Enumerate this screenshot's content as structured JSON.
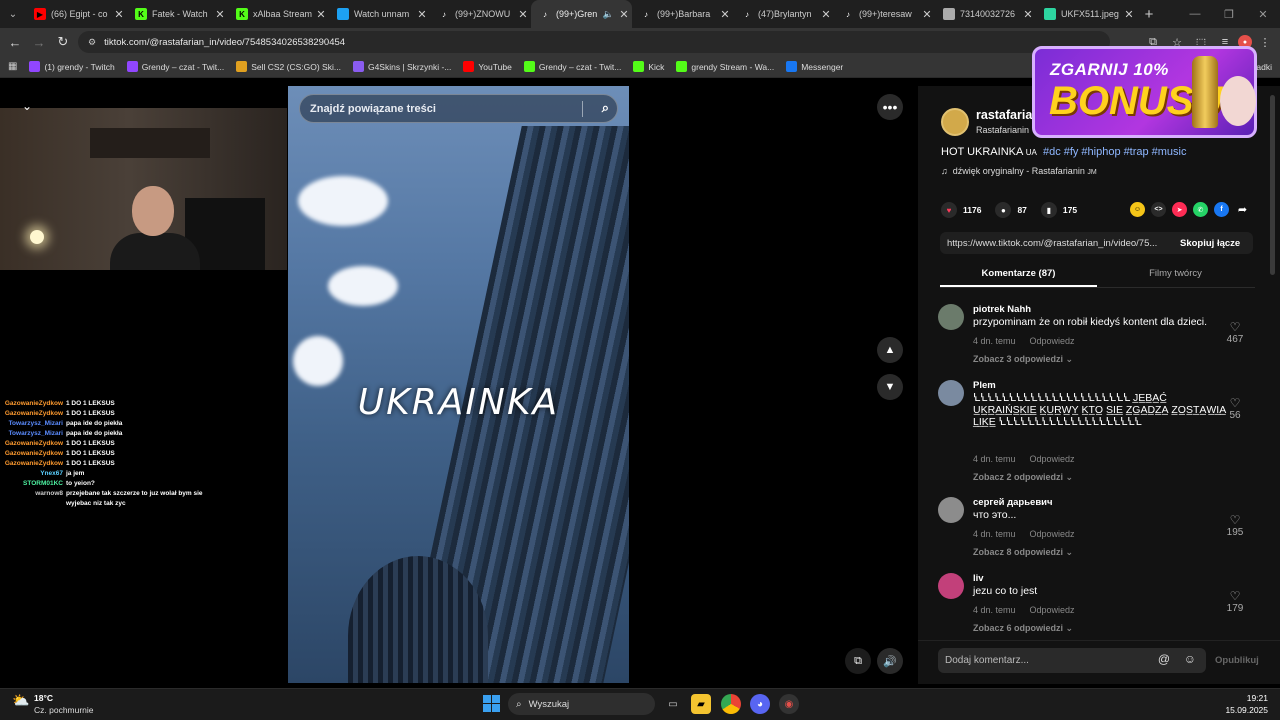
{
  "browser": {
    "tabs": [
      {
        "label": "(66) Egipt - co",
        "icon": "youtube-icon",
        "color": "#ff0000"
      },
      {
        "label": "Fatek - Watch",
        "icon": "kick-icon",
        "color": "#53fc18"
      },
      {
        "label": "xAlbaa Stream",
        "icon": "kick-icon",
        "color": "#53fc18"
      },
      {
        "label": "Watch unnam",
        "icon": "globe-icon",
        "color": "#1da1f2"
      },
      {
        "label": "(99+)ZNOWU",
        "icon": "tiktok-icon",
        "color": "#ffffff"
      },
      {
        "label": "(99+)Gren",
        "icon": "tiktok-icon",
        "color": "#ffffff",
        "active": true
      },
      {
        "label": "(99+)Barbara",
        "icon": "tiktok-icon",
        "color": "#ffffff"
      },
      {
        "label": "(47)Brylantyn",
        "icon": "tiktok-icon",
        "color": "#ffffff"
      },
      {
        "label": "(99+)teresaw",
        "icon": "tiktok-icon",
        "color": "#ffffff"
      },
      {
        "label": "73140032726",
        "icon": "globe-icon",
        "color": "#aaaaaa"
      },
      {
        "label": "UKFX511.jpeg",
        "icon": "image-icon",
        "color": "#2dd4a0"
      }
    ],
    "url": "tiktok.com/@rastafarian_in/video/7548534026538290454",
    "bookmarks": [
      {
        "label": "(1) grendy - Twitch",
        "icon": "twitch-icon",
        "color": "#9146ff"
      },
      {
        "label": "Grendy – czat - Twit...",
        "icon": "twitch-icon",
        "color": "#9146ff"
      },
      {
        "label": "Sell CS2 (CS:GO) Ski...",
        "icon": "skins-icon",
        "color": "#e0a020"
      },
      {
        "label": "G4Skins | Skrzynki -...",
        "icon": "g4skins-icon",
        "color": "#8a5cf0"
      },
      {
        "label": "YouTube",
        "icon": "youtube-icon",
        "color": "#ff0000"
      },
      {
        "label": "Grendy – czat - Twit...",
        "icon": "kick-icon",
        "color": "#53fc18"
      },
      {
        "label": "Kick",
        "icon": "kick-icon",
        "color": "#53fc18"
      },
      {
        "label": "grendy Stream - Wa...",
        "icon": "kick-icon",
        "color": "#53fc18"
      },
      {
        "label": "Messenger",
        "icon": "facebook-icon",
        "color": "#1877f2"
      }
    ],
    "bookmarks_right": "zakładki"
  },
  "stream_chat": [
    {
      "user": "GazowanieZydkow",
      "color": "#ff9b2f",
      "msg": "1 DO 1 LEKSUS"
    },
    {
      "user": "GazowanieZydkow",
      "color": "#ff9b2f",
      "msg": "1 DO 1 LEKSUS"
    },
    {
      "user": "Towarzysz_Mizari",
      "color": "#5b8cff",
      "msg": "papa ide do piekła"
    },
    {
      "user": "Towarzysz_Mizari",
      "color": "#5b8cff",
      "msg": "papa ide do piekła"
    },
    {
      "user": "GazowanieZydkow",
      "color": "#ff9b2f",
      "msg": "1 DO 1 LEKSUS"
    },
    {
      "user": "GazowanieZydkow",
      "color": "#ff9b2f",
      "msg": "1 DO 1 LEKSUS"
    },
    {
      "user": "GazowanieZydkow",
      "color": "#ff9b2f",
      "msg": "1 DO 1 LEKSUS"
    },
    {
      "user": "Ynex67",
      "color": "#5bd0ff",
      "msg": "ja jem"
    },
    {
      "user": "STORM01KC",
      "color": "#4df0a0",
      "msg": "to yeion?"
    },
    {
      "user": "warnow8",
      "color": "#cccccc",
      "msg": "przejebane tak szczerze to juz wolał bym sie"
    },
    {
      "user": "",
      "color": "#cccccc",
      "msg": "wyjebac niz tak zyc"
    }
  ],
  "video": {
    "search_placeholder": "Znajdź powiązane treści",
    "overlay_title": "UKRAINKA"
  },
  "post": {
    "author_name": "rastafaria",
    "author_handle": "Rastafarianin",
    "description_prefix": "HOT UKRAINKA",
    "description_flag": "UA",
    "hashtags": [
      "#dc",
      "#fy",
      "#hiphop",
      "#trap",
      "#music"
    ],
    "sound": "dźwięk oryginalny - Rastafarianin",
    "sound_suffix": "JM",
    "likes": "1176",
    "comments": "87",
    "saves": "175",
    "link": "https://www.tiktok.com/@rastafarian_in/video/75...",
    "copy_label": "Skopiuj łącze",
    "tab_comments": "Komentarze (87)",
    "tab_creator": "Filmy twórcy"
  },
  "comments": [
    {
      "user": "piotrek Nahh",
      "text": "przypominam że on robił kiedyś kontent dla dzieci.",
      "time": "4 dn. temu",
      "reply": "Odpowiedz",
      "more": "Zobacz 3 odpowiedzi",
      "likes": "467",
      "avatar": "#6b7b6b"
    },
    {
      "user": "Plem",
      "text": "ꝆꝆꝆꝆꝆꝆꝆꝆꝆꝆꝆꝆꝆꝆꝆꝆꝆꝆꝆꝆꝆꝆ J̲E̲B̲A̲Ć̲ U̲K̲R̲A̲I̲Ń̲S̲K̲I̲E̲ K̲U̲R̲W̲Y̲ K̲T̲O̲ S̲I̲E̲ Z̲G̲A̲D̲Z̲A̲ Z̲O̲S̲T̲A̲W̲I̲A̲ L̲I̲K̲E̲ ꝆꝆꝆꝆꝆꝆꝆꝆꝆꝆꝆꝆꝆꝆꝆꝆꝆꝆꝆꝆ",
      "time": "4 dn. temu",
      "reply": "Odpowiedz",
      "more": "Zobacz 2 odpowiedzi",
      "likes": "56",
      "avatar": "#7a8aa0"
    },
    {
      "user": "сергей дарьевич",
      "text": "что это...",
      "time": "4 dn. temu",
      "reply": "Odpowiedz",
      "more": "Zobacz 8 odpowiedzi",
      "likes": "195",
      "avatar": "#8c8c8c"
    },
    {
      "user": "liv",
      "text": "jezu co to jest",
      "time": "4 dn. temu",
      "reply": "Odpowiedz",
      "more": "Zobacz 6 odpowiedzi",
      "likes": "179",
      "avatar": "#c2407a"
    }
  ],
  "comment_box": {
    "placeholder": "Dodaj komentarz...",
    "publish": "Opublikuj"
  },
  "promo": {
    "line1": "ZGARNIJ 10%",
    "line2": "BONUSU"
  },
  "taskbar": {
    "temperature": "18°C",
    "weather": "Cz. pochmurnie",
    "search": "Wyszukaj",
    "time": "19:21",
    "date": "15.09.2025"
  }
}
